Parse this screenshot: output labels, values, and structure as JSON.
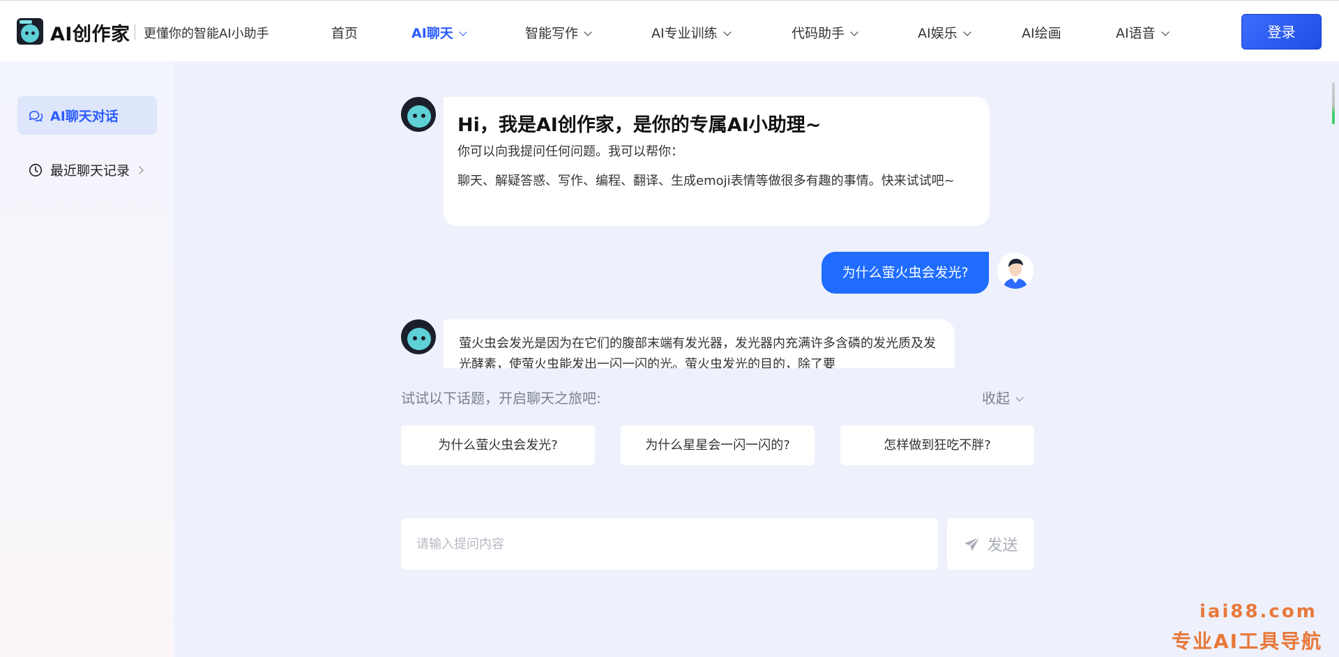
{
  "header": {
    "brand": "AI创作家",
    "tagline": "更懂你的智能AI小助手",
    "nav": [
      {
        "label": "首页",
        "dropdown": false,
        "active": false
      },
      {
        "label": "AI聊天",
        "dropdown": true,
        "active": true
      },
      {
        "label": "智能写作",
        "dropdown": true,
        "active": false
      },
      {
        "label": "AI专业训练",
        "dropdown": true,
        "active": false
      },
      {
        "label": "代码助手",
        "dropdown": true,
        "active": false
      },
      {
        "label": "AI娱乐",
        "dropdown": true,
        "active": false
      },
      {
        "label": "AI绘画",
        "dropdown": false,
        "active": false
      },
      {
        "label": "AI语音",
        "dropdown": true,
        "active": false
      }
    ],
    "login": "登录"
  },
  "sidebar": {
    "items": [
      {
        "label": "AI聊天对话",
        "icon": "chat-bubbles-icon",
        "active": true
      },
      {
        "label": "最近聊天记录",
        "icon": "clock-icon",
        "active": false
      }
    ]
  },
  "chat": {
    "greeting": {
      "title": "Hi，我是AI创作家，是你的专属AI小助理~",
      "line1": "你可以向我提问任何问题。我可以帮你：",
      "line2": "聊天、解疑答惑、写作、编程、翻译、生成emoji表情等做很多有趣的事情。快来试试吧~"
    },
    "user_question": "为什么萤火虫会发光?",
    "answer": "萤火虫会发光是因为在它们的腹部末端有发光器，发光器内充满许多含磷的发光质及发光酵素，使萤火虫能发出一闪一闪的光。萤火虫发光的目的，除了要"
  },
  "topics": {
    "label": "试试以下话题，开启聊天之旅吧:",
    "collapse": "收起",
    "items": [
      "为什么萤火虫会发光?",
      "为什么星星会一闪一闪的?",
      "怎样做到狂吃不胖?"
    ]
  },
  "composer": {
    "placeholder": "请输入提问内容",
    "send": "发送"
  },
  "watermark": {
    "domain": "iai88.com",
    "slogan": "专业AI工具导航"
  },
  "colors": {
    "accent": "#2a5bff",
    "user_bubble": "#1f6cff",
    "page_bg": "#eef1fb",
    "watermark": "#e8783a"
  }
}
